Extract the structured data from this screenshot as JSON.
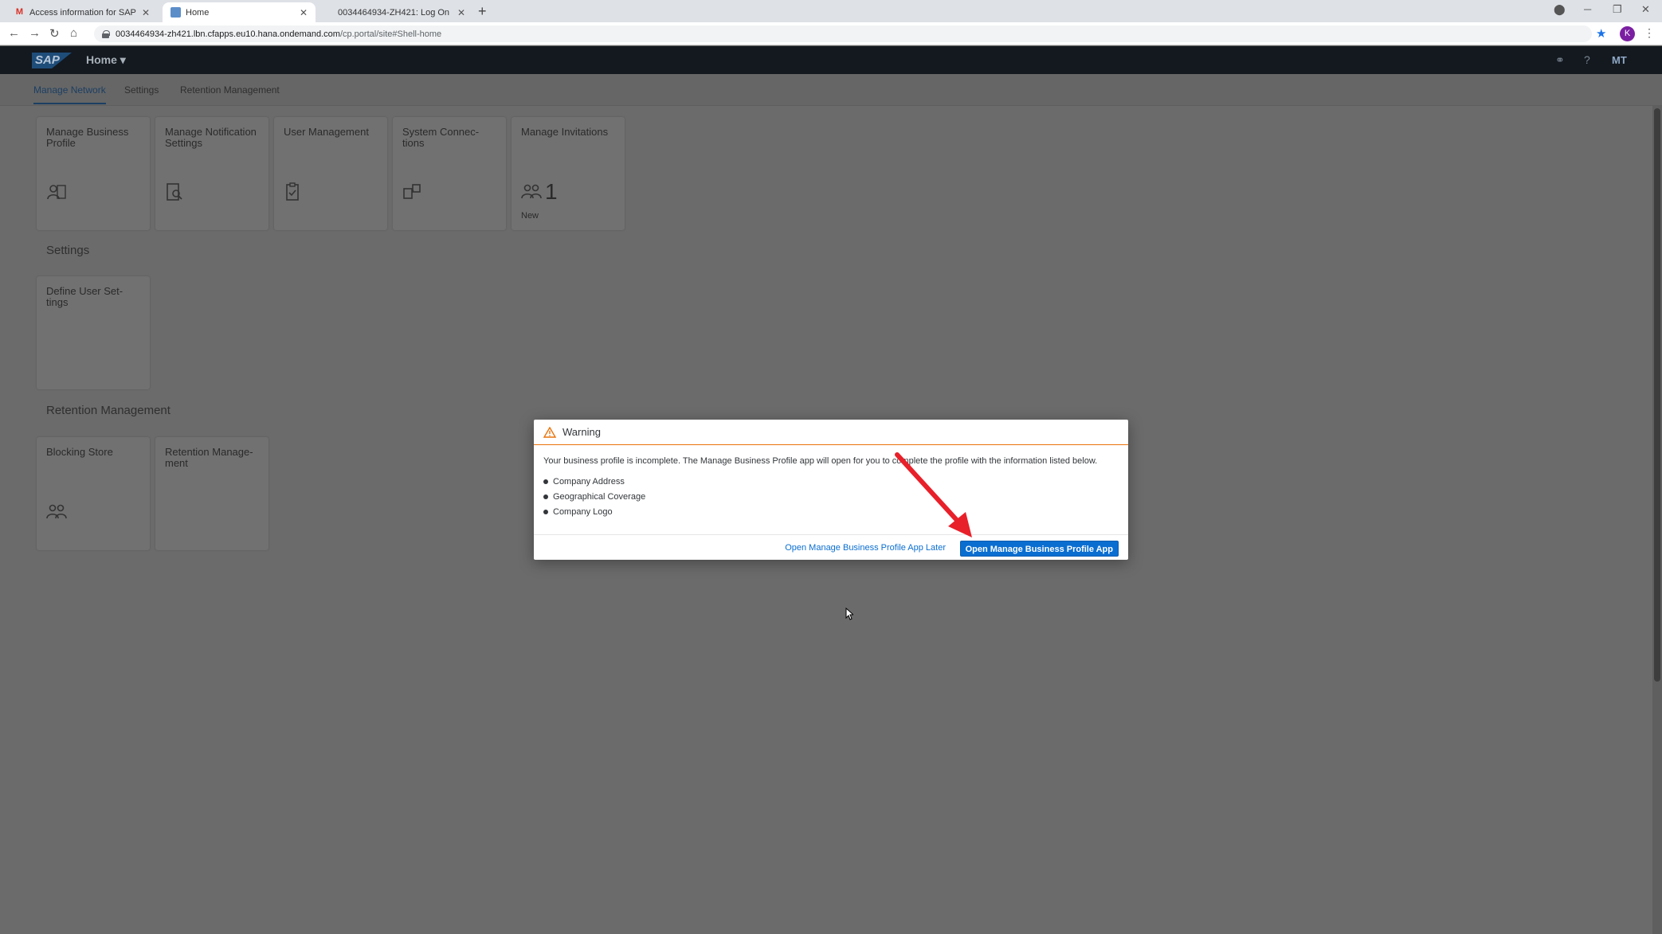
{
  "browser": {
    "tabs": [
      {
        "title": "Access information for SAP Logi",
        "favicon": "gmail-icon"
      },
      {
        "title": "Home",
        "favicon": "sap-icon"
      },
      {
        "title": "0034464934-ZH421: Log On",
        "favicon": "none"
      }
    ],
    "url_main": "0034464934-zh421.lbn.cfapps.eu10.hana.ondemand.com",
    "url_path": "/cp.portal/site#Shell-home",
    "profile_initial": "K"
  },
  "shell": {
    "logo": "SAP",
    "home_label": "Home ▾",
    "avatar": "MT"
  },
  "subnav": {
    "tabs": [
      "Manage Network",
      "Settings",
      "Retention Management"
    ]
  },
  "sections": {
    "settings_title": "Settings",
    "retention_title": "Retention Management"
  },
  "tiles": {
    "manage_business_profile": "Manage Business Profile",
    "manage_notification_settings": "Manage Notification Settings",
    "user_management": "User Management",
    "system_connections": "System Connec-tions",
    "manage_invitations": "Manage Invitations",
    "manage_invitations_count": "1",
    "manage_invitations_info": "New",
    "define_user_settings": "Define User Set-tings",
    "blocking_store": "Blocking Store",
    "retention_management": "Retention Manage-ment"
  },
  "dialog": {
    "title": "Warning",
    "message": "Your business profile is incomplete. The Manage Business Profile app will open for you to complete the profile with the information listed below.",
    "items": [
      "Company Address",
      "Geographical Coverage",
      "Company Logo"
    ],
    "later_button": "Open Manage Business Profile App Later",
    "open_button": "Open Manage Business Profile App"
  },
  "colors": {
    "accent": "#0a6ed1",
    "warning": "#e9730c",
    "annotation_arrow": "#e8202a"
  }
}
